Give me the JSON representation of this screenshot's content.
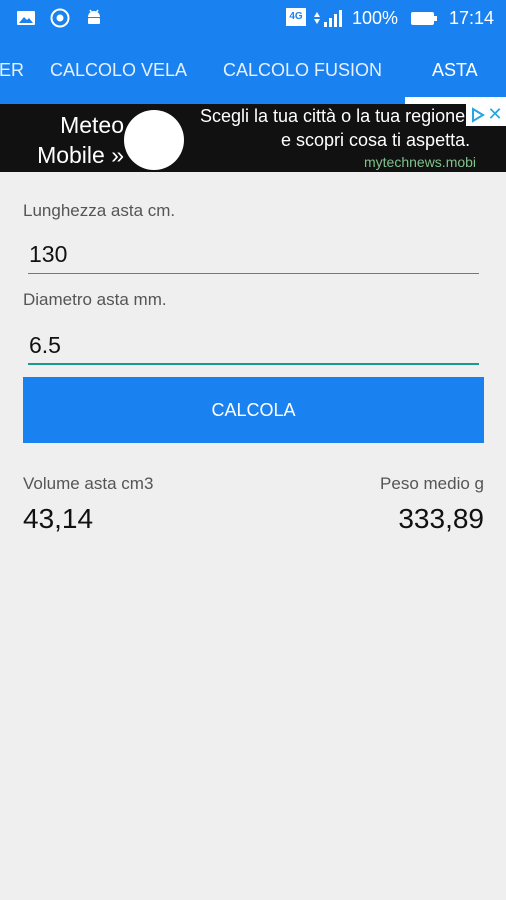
{
  "status_bar": {
    "network": "4G",
    "battery": "100%",
    "time": "17:14"
  },
  "tabs": [
    {
      "label": "ER"
    },
    {
      "label": "CALCOLO VELA"
    },
    {
      "label": "CALCOLO FUSION"
    },
    {
      "label": "ASTA"
    }
  ],
  "ad": {
    "left_text_1": "Meteo",
    "left_text_2": "Mobile »",
    "line1": "Scegli la tua città o la tua regione",
    "line2": "e scopri cosa ti aspetta.",
    "domain": "mytechnews.mobi",
    "close": "✕"
  },
  "form": {
    "length_label": "Lunghezza asta cm.",
    "length_value": "130",
    "diameter_label": "Diametro asta mm.",
    "diameter_value": "6.5",
    "calc_button": "CALCOLA"
  },
  "results": {
    "volume_label": "Volume asta cm3",
    "volume_value": "43,14",
    "weight_label": "Peso medio g",
    "weight_value": "333,89"
  }
}
